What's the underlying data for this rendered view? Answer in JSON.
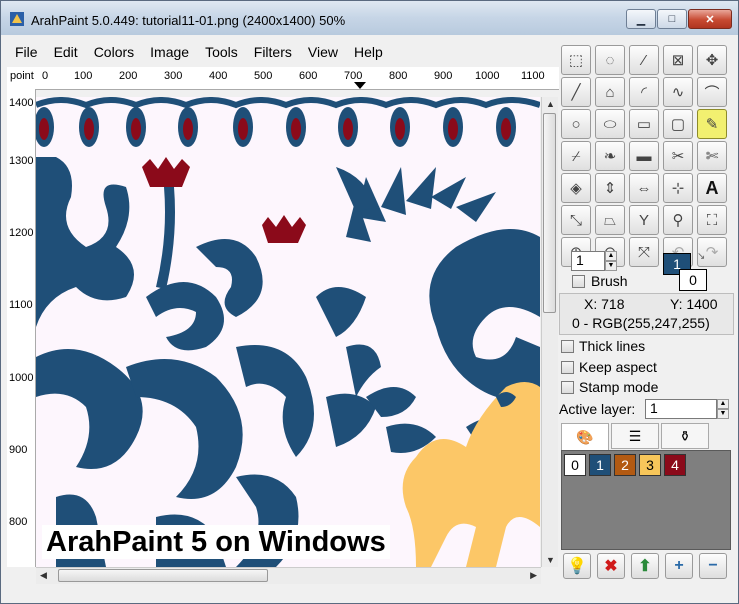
{
  "window": {
    "title": "ArahPaint 5.0.449: tutorial11-01.png  (2400x1400) 50%"
  },
  "menu": [
    "File",
    "Edit",
    "Colors",
    "Image",
    "Tools",
    "Filters",
    "View",
    "Help"
  ],
  "ruler_h": {
    "unit": "point",
    "labels": [
      "0",
      "100",
      "200",
      "300",
      "400",
      "500",
      "600",
      "700",
      "800",
      "900",
      "1000",
      "1100"
    ]
  },
  "ruler_v": {
    "labels": [
      "1400",
      "1300",
      "1200",
      "1100",
      "1000",
      "900",
      "800"
    ]
  },
  "overlay": "ArahPaint 5 on Windows",
  "brush": {
    "size": "1",
    "label": "Brush",
    "fg_color_index": "1",
    "bg_color_index": "0"
  },
  "coords": {
    "x": "X: 718",
    "y": "Y: 1400",
    "pixel": "0 - RGB(255,247,255)"
  },
  "options": {
    "thick_lines": "Thick lines",
    "keep_aspect": "Keep aspect",
    "stamp_mode": "Stamp mode"
  },
  "layer": {
    "label": "Active layer:",
    "value": "1"
  },
  "palette": [
    {
      "label": "0",
      "color": "#ffffff",
      "text": "#000000"
    },
    {
      "label": "1",
      "color": "#1f4f78",
      "text": "#ffffff"
    },
    {
      "label": "2",
      "color": "#b35a12",
      "text": "#ffffff"
    },
    {
      "label": "3",
      "color": "#f7c65a",
      "text": "#000000"
    },
    {
      "label": "4",
      "color": "#8b0a1a",
      "text": "#ffffff"
    }
  ],
  "colors": {
    "blue": "#1f4f78",
    "red": "#8b0a1a",
    "yellow": "#fcc767",
    "canvas_bg": "#fdf6fd"
  }
}
